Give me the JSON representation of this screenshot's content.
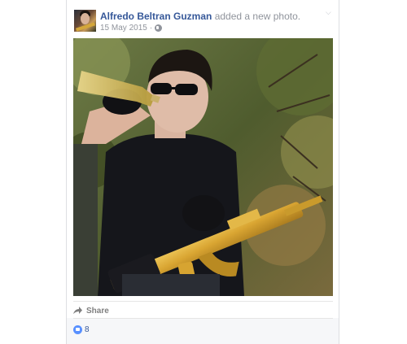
{
  "post": {
    "author": "Alfredo Beltran Guzman",
    "action": "added a new photo.",
    "date": "15 May 2015",
    "separator": "·",
    "privacy_icon": "globe-icon",
    "options_icon": "chevron-down-icon"
  },
  "actions": {
    "share_label": "Share",
    "share_icon": "share-arrow-icon"
  },
  "reactions": {
    "like_icon": "like-thumb-icon",
    "count": "8"
  },
  "colors": {
    "link": "#365899",
    "meta": "#90949c",
    "action_text": "#7f7f7f",
    "like_blue": "#5890ff",
    "footer_bg": "#f6f7f9"
  }
}
